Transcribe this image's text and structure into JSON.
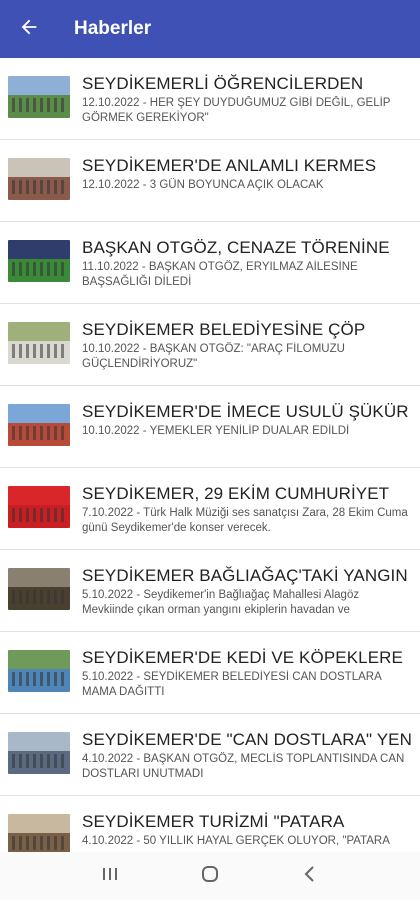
{
  "appbar": {
    "title": "Haberler",
    "back_icon": "arrow-back-icon",
    "color": "#3f51b5"
  },
  "news": [
    {
      "title": "SEYDİKEMERLİ ÖĞRENCİLERDEN",
      "desc": "12.10.2022 - HER ŞEY DUYDUĞUMUZ GİBİ DEĞİL, GELİP GÖRMEK GEREKİYOR\"",
      "sky": "#8fb0d6",
      "ground": "#5d8c4a"
    },
    {
      "title": "SEYDİKEMER'DE ANLAMLI KERMES",
      "desc": "12.10.2022 - 3 GÜN BOYUNCA AÇIK OLACAK",
      "sky": "#c9c3b8",
      "ground": "#8a5a4a"
    },
    {
      "title": "BAŞKAN OTGÖZ, CENAZE TÖRENİNE",
      "desc": "11.10.2022 - BAŞKAN OTGÖZ, ERYILMAZ AİLESİNE BAŞSAĞLIĞI DİLEDİ",
      "sky": "#2e3d6b",
      "ground": "#3a8a3a"
    },
    {
      "title": "SEYDİKEMER BELEDİYESİNE ÇÖP",
      "desc": "10.10.2022 - BAŞKAN OTGÖZ: \"ARAÇ FİLOMUZU GÜÇLENDİRİYORUZ\"",
      "sky": "#9fb07a",
      "ground": "#d9d9d2"
    },
    {
      "title": "SEYDİKEMER'DE İMECE USULÜ ŞÜKÜR",
      "desc": "10.10.2022 - YEMEKLER YENİLİP DUALAR EDİLDİ",
      "sky": "#7aa6d8",
      "ground": "#b84a3a"
    },
    {
      "title": "SEYDİKEMER, 29 EKİM CUMHURİYET",
      "desc": "7.10.2022 - Türk Halk Müziği ses sanatçısı Zara, 28 Ekim Cuma günü Seydikemer'de konser verecek.",
      "sky": "#d8262a",
      "ground": "#c91e22"
    },
    {
      "title": "SEYDİKEMER BAĞLIAĞAÇ'TAKİ YANGIN",
      "desc": "5.10.2022 - Seydikemer'in Bağlıağaç Mahallesi Alagöz Mevkiinde çıkan orman yangını ekiplerin havadan ve",
      "sky": "#8a8070",
      "ground": "#4a4030"
    },
    {
      "title": "SEYDİKEMER'DE KEDİ VE KÖPEKLERE",
      "desc": "5.10.2022 - SEYDİKEMER BELEDİYESİ CAN DOSTLARA MAMA DAĞITTI",
      "sky": "#6f9a5a",
      "ground": "#4f86b8"
    },
    {
      "title": "SEYDİKEMER'DE \"CAN DOSTLARA\" YENİ",
      "desc": "4.10.2022 - BAŞKAN OTGÖZ, MECLİS TOPLANTISINDA CAN DOSTLARI UNUTMADI",
      "sky": "#a8b8c8",
      "ground": "#5a6a80"
    },
    {
      "title": "SEYDİKEMER TURİZMİ \"PATARA",
      "desc": "4.10.2022 - 50 YILLIK HAYAL GERÇEK OLUYOR, \"PATARA",
      "sky": "#c8b8a0",
      "ground": "#7a6048"
    }
  ],
  "navbar": {
    "recents_icon": "recents-icon",
    "home_icon": "home-icon",
    "back_icon": "nav-back-icon"
  }
}
